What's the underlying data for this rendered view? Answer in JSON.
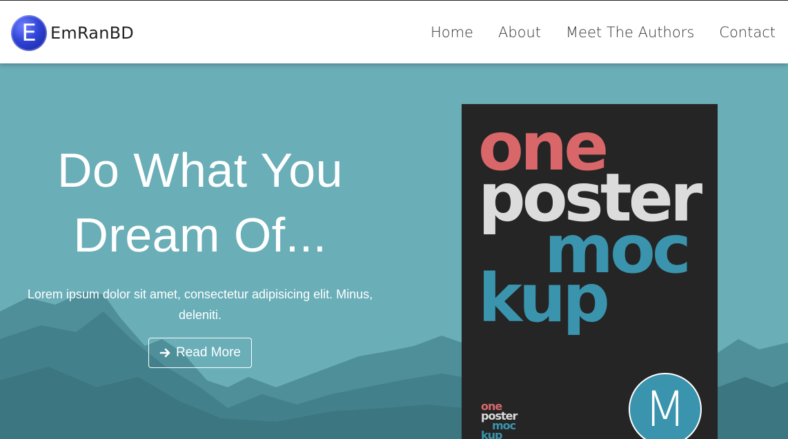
{
  "brand": {
    "logo_letter": "E",
    "name": "EmRanBD"
  },
  "nav": {
    "items": [
      "Home",
      "About",
      "Meet The Authors",
      "Contact"
    ]
  },
  "hero": {
    "title_line1": "Do What You",
    "title_line2": "Dream Of...",
    "subtitle": "Lorem ipsum dolor sit amet, consectetur adipisicing elit. Minus, deleniti.",
    "button_label": "Read More",
    "button_icon": "arrow-right-icon",
    "background_color": "#6aaeb8"
  },
  "poster": {
    "word1": "one",
    "word2": "poster",
    "word3": "moc",
    "word4": "kup",
    "mini": [
      "one",
      "poster",
      "moc",
      "kup"
    ],
    "badge_letter": "M",
    "colors": {
      "red": "#d9676a",
      "light": "#dcdcdc",
      "teal": "#3a94ad",
      "bg": "#252525"
    }
  }
}
